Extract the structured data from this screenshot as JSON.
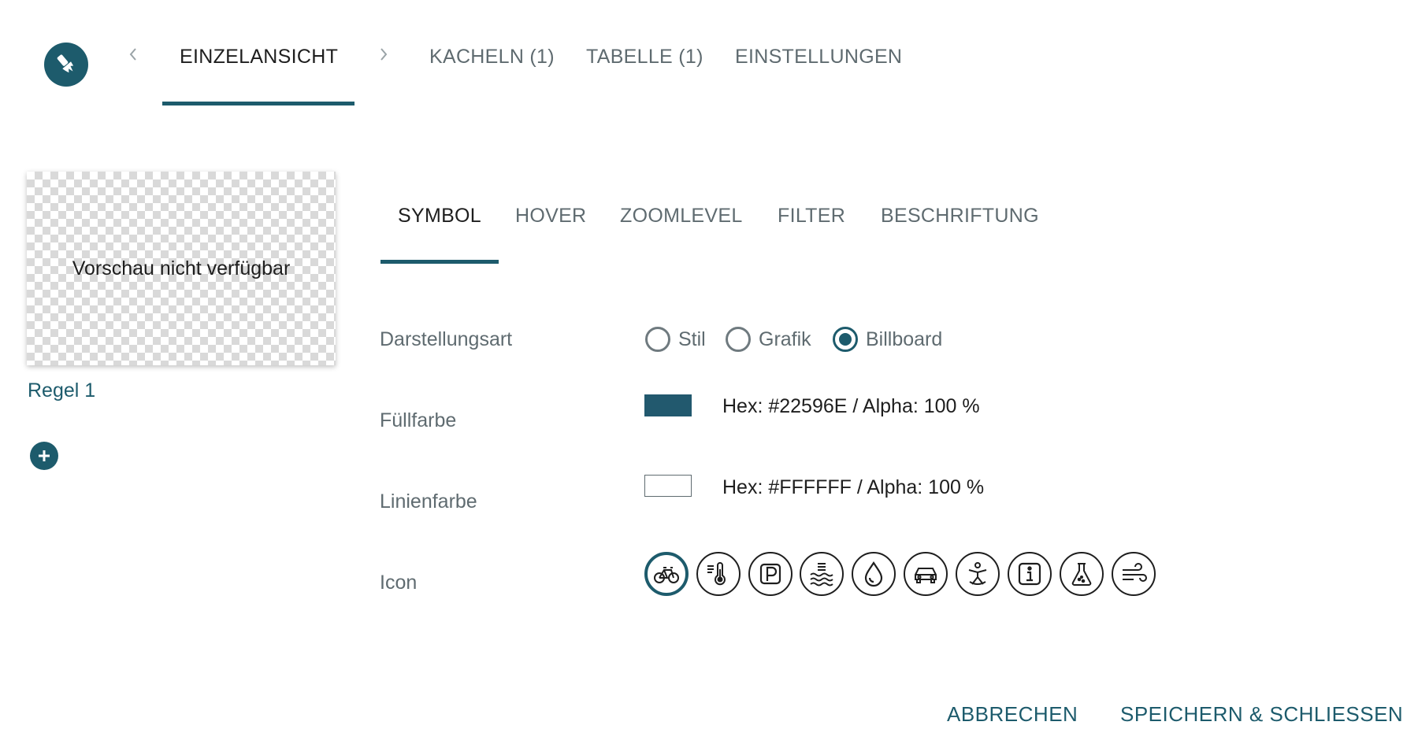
{
  "top_tabs": [
    {
      "label": "EINZELANSICHT",
      "active": true
    },
    {
      "label": "KACHELN (1)",
      "active": false
    },
    {
      "label": "TABELLE (1)",
      "active": false
    },
    {
      "label": "EINSTELLUNGEN",
      "active": false
    }
  ],
  "preview": {
    "text": "Vorschau nicht verfügbar"
  },
  "rules": [
    {
      "label": "Regel 1"
    }
  ],
  "sub_tabs": [
    {
      "label": "SYMBOL",
      "active": true
    },
    {
      "label": "HOVER",
      "active": false
    },
    {
      "label": "ZOOMLEVEL",
      "active": false
    },
    {
      "label": "FILTER",
      "active": false
    },
    {
      "label": "BESCHRIFTUNG",
      "active": false
    }
  ],
  "form": {
    "display_type": {
      "label": "Darstellungsart",
      "options": [
        {
          "label": "Stil",
          "checked": false
        },
        {
          "label": "Grafik",
          "checked": false
        },
        {
          "label": "Billboard",
          "checked": true
        }
      ]
    },
    "fill_color": {
      "label": "Füllfarbe",
      "hex": "#22596E",
      "text": "Hex: #22596E / Alpha: 100 %"
    },
    "line_color": {
      "label": "Linienfarbe",
      "hex": "#FFFFFF",
      "text": "Hex: #FFFFFF / Alpha: 100 %"
    },
    "icon": {
      "label": "Icon",
      "options": [
        "bicycle-icon",
        "temperature-icon",
        "parking-icon",
        "water-level-icon",
        "water-drop-icon",
        "car-icon",
        "person-icon",
        "info-icon",
        "flask-icon",
        "wind-icon"
      ],
      "selected": "bicycle-icon"
    }
  },
  "actions": {
    "cancel": "ABBRECHEN",
    "save": "SPEICHERN & SCHLIESSEN"
  },
  "colors": {
    "accent": "#1d5b6c",
    "text": "#1e1e1e",
    "muted": "#5f6b70"
  }
}
